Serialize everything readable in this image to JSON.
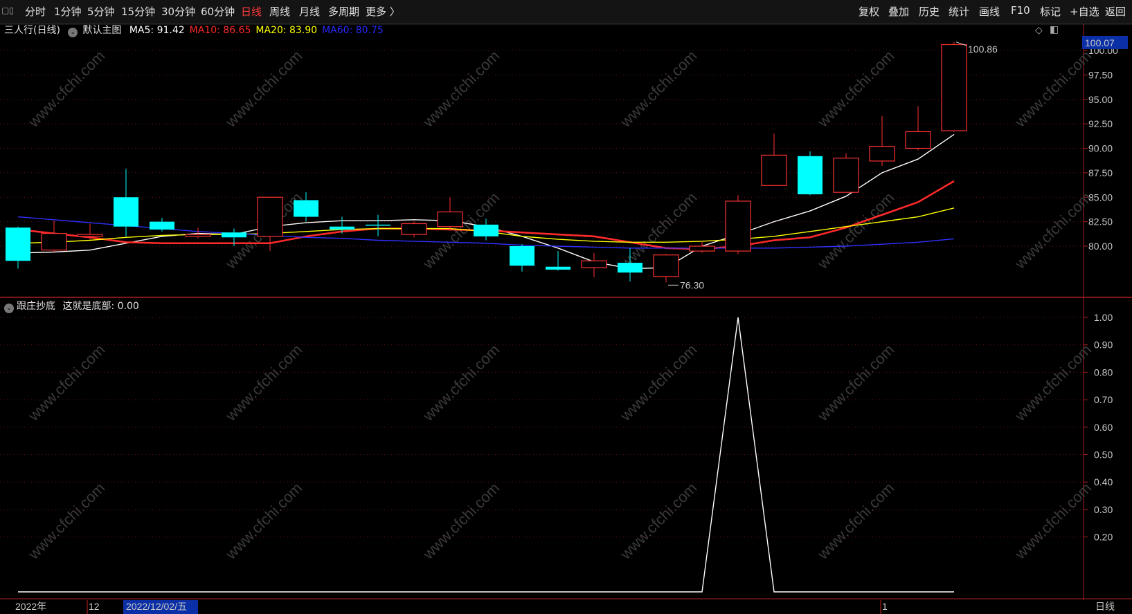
{
  "toolbar": {
    "left_items": [
      {
        "label": "分时",
        "active": false
      },
      {
        "label": "1分钟",
        "active": false
      },
      {
        "label": "5分钟",
        "active": false
      },
      {
        "label": "15分钟",
        "active": false
      },
      {
        "label": "30分钟",
        "active": false
      },
      {
        "label": "60分钟",
        "active": false
      },
      {
        "label": "日线",
        "active": true
      },
      {
        "label": "周线",
        "active": false
      },
      {
        "label": "月线",
        "active": false
      },
      {
        "label": "多周期",
        "active": false
      },
      {
        "label": "更多 〉",
        "active": false
      }
    ],
    "right_items": [
      "复权",
      "叠加",
      "历史",
      "统计",
      "画线",
      "F10",
      "标记",
      "+自选",
      "返回"
    ]
  },
  "main_panel": {
    "stock_title": "三人行(日线)",
    "chart_name": "默认主图",
    "ma": [
      {
        "label": "MA5: 91.42",
        "color": "#ffffff"
      },
      {
        "label": "MA10: 86.65",
        "color": "#ff2a2a"
      },
      {
        "label": "MA20: 83.90",
        "color": "#ffff00"
      },
      {
        "label": "MA60: 80.75",
        "color": "#2a2aff"
      }
    ],
    "current_price_tag": "100.07",
    "high_label": "100.86",
    "low_label": "76.30"
  },
  "indicator_panel": {
    "title": "跟庄抄底",
    "value_label": "这就是底部: 0.00"
  },
  "bottom_bar": {
    "year_label": "2022年",
    "month_label": "12",
    "cursor_date": "2022/12/02/五",
    "month2_label": "1",
    "period_label": "日线"
  },
  "watermark": "www.cfchi.com",
  "chart_data": [
    {
      "type": "candlestick",
      "title": "三人行(日线)",
      "ylim": [
        76.3,
        100.86
      ],
      "y_ticks": [
        80.0,
        82.5,
        85.0,
        87.5,
        90.0,
        92.5,
        95.0,
        97.5,
        100.0
      ],
      "candles": [
        {
          "o": 81.9,
          "h": 82.0,
          "l": 77.7,
          "c": 78.5
        },
        {
          "o": 79.6,
          "h": 82.6,
          "l": 79.4,
          "c": 81.3
        },
        {
          "o": 81.0,
          "h": 82.3,
          "l": 80.7,
          "c": 81.2
        },
        {
          "o": 85.0,
          "h": 87.9,
          "l": 81.0,
          "c": 82.0
        },
        {
          "o": 82.5,
          "h": 82.9,
          "l": 81.5,
          "c": 81.7
        },
        {
          "o": 81.0,
          "h": 81.9,
          "l": 80.8,
          "c": 81.2
        },
        {
          "o": 81.4,
          "h": 81.8,
          "l": 80.0,
          "c": 80.9
        },
        {
          "o": 81.0,
          "h": 85.0,
          "l": 79.5,
          "c": 85.0
        },
        {
          "o": 84.7,
          "h": 85.5,
          "l": 82.5,
          "c": 83.0
        },
        {
          "o": 82.0,
          "h": 83.0,
          "l": 81.3,
          "c": 81.7
        },
        {
          "o": 82.2,
          "h": 83.2,
          "l": 81.0,
          "c": 82.1
        },
        {
          "o": 81.2,
          "h": 82.5,
          "l": 80.9,
          "c": 82.3
        },
        {
          "o": 82.0,
          "h": 85.0,
          "l": 81.6,
          "c": 83.5
        },
        {
          "o": 82.2,
          "h": 82.8,
          "l": 80.6,
          "c": 81.0
        },
        {
          "o": 80.0,
          "h": 80.2,
          "l": 77.4,
          "c": 78.0
        },
        {
          "o": 77.9,
          "h": 79.5,
          "l": 77.5,
          "c": 77.6
        },
        {
          "o": 77.8,
          "h": 79.3,
          "l": 76.8,
          "c": 78.5
        },
        {
          "o": 78.3,
          "h": 79.8,
          "l": 76.4,
          "c": 77.3
        },
        {
          "o": 76.9,
          "h": 79.2,
          "l": 76.3,
          "c": 79.1
        },
        {
          "o": 79.5,
          "h": 80.4,
          "l": 79.3,
          "c": 80.0
        },
        {
          "o": 79.5,
          "h": 85.2,
          "l": 79.2,
          "c": 84.6
        },
        {
          "o": 86.2,
          "h": 91.5,
          "l": 86.2,
          "c": 89.3
        },
        {
          "o": 89.2,
          "h": 89.7,
          "l": 85.2,
          "c": 85.3
        },
        {
          "o": 85.5,
          "h": 89.5,
          "l": 85.5,
          "c": 89.0
        },
        {
          "o": 88.7,
          "h": 93.3,
          "l": 88.2,
          "c": 90.2
        },
        {
          "o": 90.0,
          "h": 94.3,
          "l": 89.8,
          "c": 91.7
        },
        {
          "o": 91.8,
          "h": 100.86,
          "l": 91.7,
          "c": 100.6
        }
      ],
      "ma_series": [
        {
          "name": "MA5",
          "color": "#ffffff",
          "values": [
            79.3,
            79.4,
            79.6,
            80.3,
            81.0,
            81.3,
            81.2,
            82.0,
            82.4,
            82.6,
            82.6,
            82.7,
            82.6,
            82.0,
            81.0,
            79.8,
            78.4,
            77.7,
            77.8,
            80.0,
            81.2,
            82.5,
            83.6,
            85.1,
            87.5,
            88.9,
            91.42
          ]
        },
        {
          "name": "MA10",
          "color": "#ff2a2a",
          "values": [
            81.7,
            81.3,
            80.9,
            80.4,
            80.3,
            80.3,
            80.3,
            80.3,
            81.0,
            81.5,
            81.8,
            81.8,
            81.7,
            81.6,
            81.4,
            81.2,
            81.0,
            80.4,
            79.8,
            79.7,
            80.0,
            80.6,
            80.9,
            81.9,
            83.2,
            84.5,
            86.65
          ]
        },
        {
          "name": "MA20",
          "color": "#ffff00",
          "values": [
            80.3,
            80.4,
            80.6,
            80.9,
            81.1,
            81.2,
            81.2,
            81.3,
            81.5,
            81.7,
            81.8,
            81.8,
            81.8,
            81.5,
            81.0,
            80.7,
            80.5,
            80.4,
            80.4,
            80.5,
            80.7,
            81.0,
            81.5,
            82.0,
            82.5,
            83.0,
            83.9
          ]
        },
        {
          "name": "MA60",
          "color": "#3030ff",
          "values": [
            83.0,
            82.7,
            82.4,
            82.1,
            81.8,
            81.5,
            81.3,
            81.1,
            80.9,
            80.8,
            80.6,
            80.5,
            80.4,
            80.3,
            80.1,
            80.0,
            79.9,
            79.8,
            79.8,
            79.8,
            79.8,
            79.8,
            79.9,
            80.0,
            80.2,
            80.4,
            80.75
          ]
        }
      ]
    },
    {
      "type": "line",
      "title": "跟庄抄底",
      "series": [
        {
          "name": "这就是底部",
          "color": "#ffffff",
          "values": [
            0,
            0,
            0,
            0,
            0,
            0,
            0,
            0,
            0,
            0,
            0,
            0,
            0,
            0,
            0,
            0,
            0,
            0,
            0,
            0,
            1,
            0,
            0,
            0,
            0,
            0,
            0
          ]
        }
      ],
      "ylim": [
        0,
        1.0
      ],
      "y_ticks": [
        0.2,
        0.3,
        0.4,
        0.5,
        0.6,
        0.7,
        0.8,
        0.9,
        1.0
      ]
    }
  ]
}
